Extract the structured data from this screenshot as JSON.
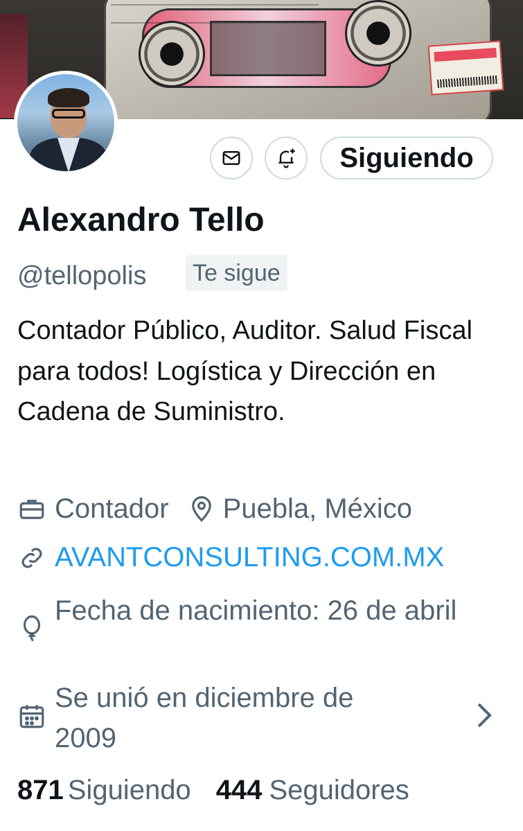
{
  "profile": {
    "name": "Alexandro Tello",
    "handle": "@tellopolis",
    "follows_you": "Te sigue",
    "bio": "Contador Público, Auditor. Salud Fiscal para todos! Logística y Dirección en Cadena de Suministro.",
    "profession": "Contador",
    "location": "Puebla, México",
    "website": "AVANTCONSULTING.COM.MX",
    "birthday": "Fecha de nacimiento: 26 de abril",
    "joined": "Se unió en diciembre de 2009"
  },
  "actions": {
    "message_icon": "envelope-icon",
    "notify_icon": "bell-plus-icon",
    "follow_label": "Siguiendo"
  },
  "stats": {
    "following_count": "871",
    "following_label": "Siguiendo",
    "followers_count": "444",
    "followers_label": "Seguidores"
  },
  "icons": {
    "profession": "briefcase-icon",
    "location": "location-pin-icon",
    "website": "link-icon",
    "birthday": "balloon-icon",
    "joined": "calendar-icon",
    "more": "chevron-right-icon"
  },
  "colors": {
    "text_primary": "#0f1419",
    "text_secondary": "#536471",
    "link": "#1d9bf0",
    "border": "#cfd9de"
  }
}
